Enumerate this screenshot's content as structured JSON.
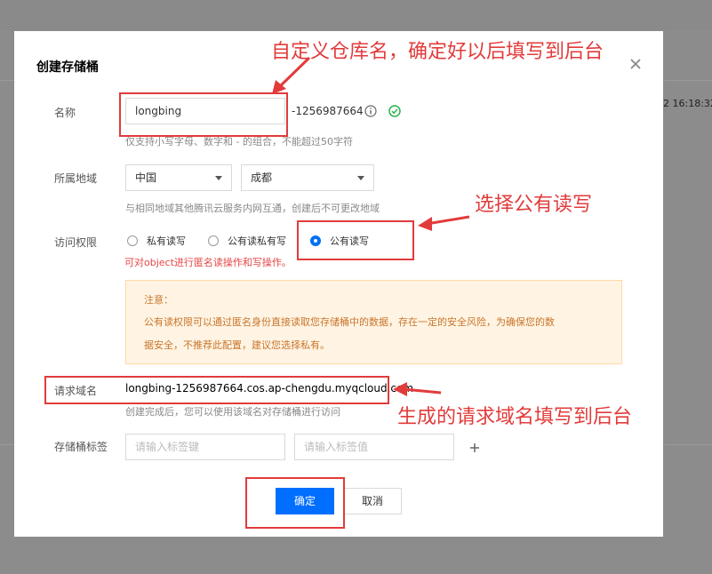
{
  "background": {
    "timestamp_fragment": "2 16:18:32"
  },
  "dialog": {
    "title": "创建存储桶",
    "name": {
      "label": "名称",
      "value": "longbing",
      "suffix": "-1256987664",
      "hint": "仅支持小写字母、数字和 - 的组合，不能超过50字符"
    },
    "region": {
      "label": "所属地域",
      "country": "中国",
      "city": "成都",
      "hint": "与相同地域其他腾讯云服务内网互通，创建后不可更改地域"
    },
    "access": {
      "label": "访问权限",
      "options": [
        "私有读写",
        "公有读私有写",
        "公有读写"
      ],
      "selected": "公有读写",
      "warning": "可对object进行匿名读操作和写操作。"
    },
    "notice": {
      "title": "注意：",
      "line1": "公有读权限可以通过匿名身份直接读取您存储桶中的数据，存在一定的安全风险，为确保您的数",
      "line2": "据安全，不推荐此配置，建议您选择私有。"
    },
    "domain": {
      "label": "请求域名",
      "value": "longbing-1256987664.cos.ap-chengdu.myqcloud.com",
      "hint": "创建完成后，您可以使用该域名对存储桶进行访问"
    },
    "tags": {
      "label": "存储桶标签",
      "key_placeholder": "请输入标签键",
      "value_placeholder": "请输入标签值"
    },
    "buttons": {
      "ok": "确定",
      "cancel": "取消"
    }
  },
  "annotations": {
    "a1": "自定义仓库名，确定好以后填写到后台",
    "a2": "选择公有读写",
    "a3": "生成的请求域名填写到后台",
    "color": "#e23b3b"
  },
  "colors": {
    "primary": "#006eff",
    "success": "#29b34c",
    "warning_bg": "#fff4e3",
    "warning_text": "#c9752c",
    "error": "#e54545"
  }
}
